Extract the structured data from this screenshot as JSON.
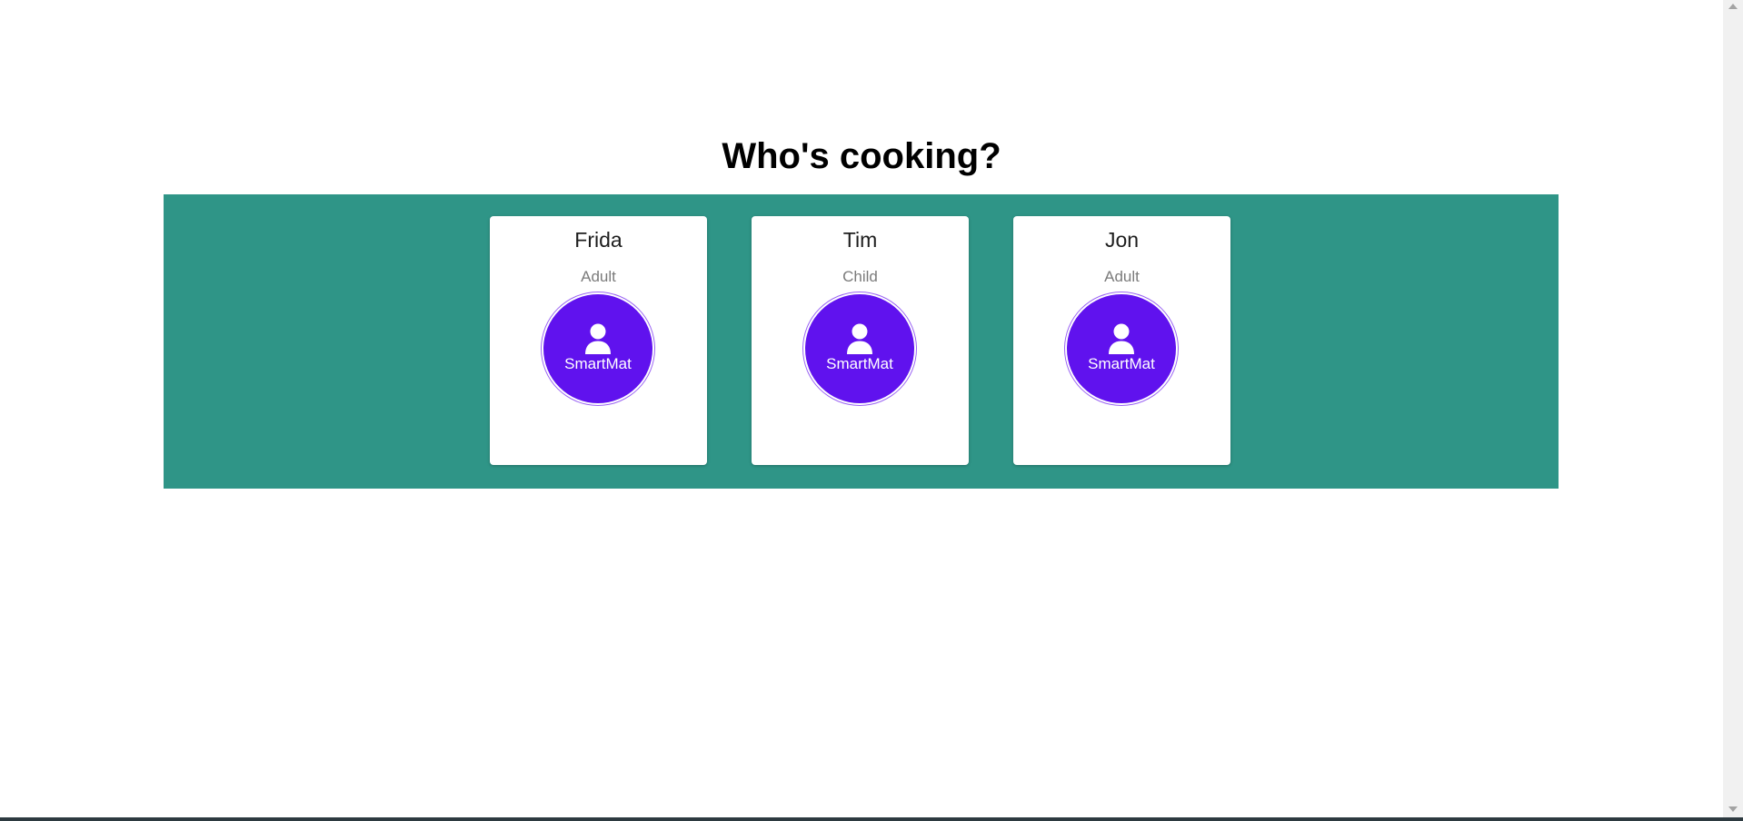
{
  "page": {
    "title": "Who's cooking?"
  },
  "colors": {
    "band": "#2f9587",
    "avatar": "#6012ee",
    "avatar_ring": "#9a63f3"
  },
  "profiles": [
    {
      "name": "Frida",
      "role": "Adult",
      "avatar_label": "SmartMat",
      "icon": "user-icon"
    },
    {
      "name": "Tim",
      "role": "Child",
      "avatar_label": "SmartMat",
      "icon": "user-icon"
    },
    {
      "name": "Jon",
      "role": "Adult",
      "avatar_label": "SmartMat",
      "icon": "user-icon"
    }
  ]
}
